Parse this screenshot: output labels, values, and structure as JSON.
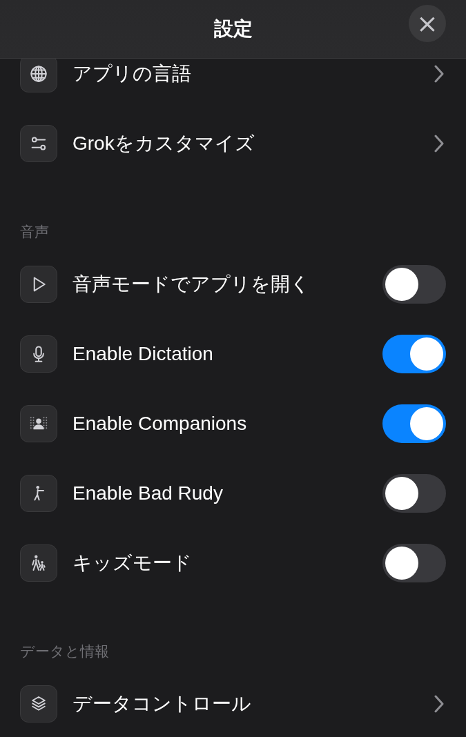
{
  "header": {
    "title": "設定",
    "close": "×"
  },
  "sections": [
    {
      "items": [
        {
          "label": "アプリの言語",
          "kind": "link"
        },
        {
          "label": "Grokをカスタマイズ",
          "kind": "link"
        }
      ]
    },
    {
      "heading": "音声",
      "items": [
        {
          "label": "音声モードでアプリを開く",
          "kind": "toggle",
          "on": false
        },
        {
          "label": "Enable Dictation",
          "kind": "toggle",
          "on": true
        },
        {
          "label": "Enable Companions",
          "kind": "toggle",
          "on": true
        },
        {
          "label": "Enable Bad Rudy",
          "kind": "toggle",
          "on": false
        },
        {
          "label": "キッズモード",
          "kind": "toggle",
          "on": false
        }
      ]
    },
    {
      "heading": "データと情報",
      "items": [
        {
          "label": "データコントロール",
          "kind": "link"
        }
      ]
    }
  ]
}
